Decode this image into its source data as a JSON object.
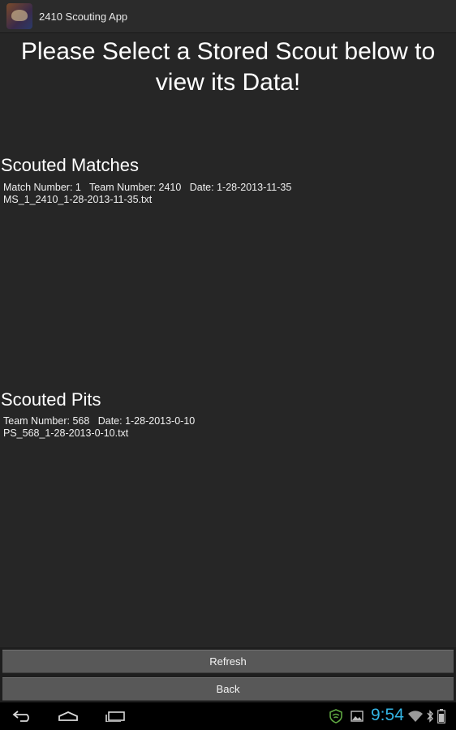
{
  "app": {
    "title": "2410 Scouting App",
    "icon": "team-robot-logo-icon"
  },
  "main": {
    "headline": "Please Select a Stored Scout below to view its Data!",
    "matches": {
      "title": "Scouted Matches",
      "items": [
        {
          "summary": "Match Number: 1   Team Number: 2410   Date: 1-28-2013-11-35",
          "file": "MS_1_2410_1-28-2013-11-35.txt"
        }
      ]
    },
    "pits": {
      "title": "Scouted Pits",
      "items": [
        {
          "summary": "Team Number: 568   Date: 1-28-2013-0-10",
          "file": "PS_568_1-28-2013-0-10.txt"
        }
      ]
    }
  },
  "buttons": {
    "refresh_label": "Refresh",
    "back_label": "Back"
  },
  "statusbar": {
    "time": "9:54",
    "icons": [
      "shield-icon",
      "image-icon",
      "wifi-icon",
      "bluetooth-icon",
      "battery-icon"
    ]
  },
  "navbar": {
    "icons": [
      "back-icon",
      "home-icon",
      "recent-apps-icon"
    ]
  },
  "colors": {
    "accent": "#33b5e5",
    "background": "#262626",
    "button": "#585858",
    "shield": "#5fa842"
  }
}
